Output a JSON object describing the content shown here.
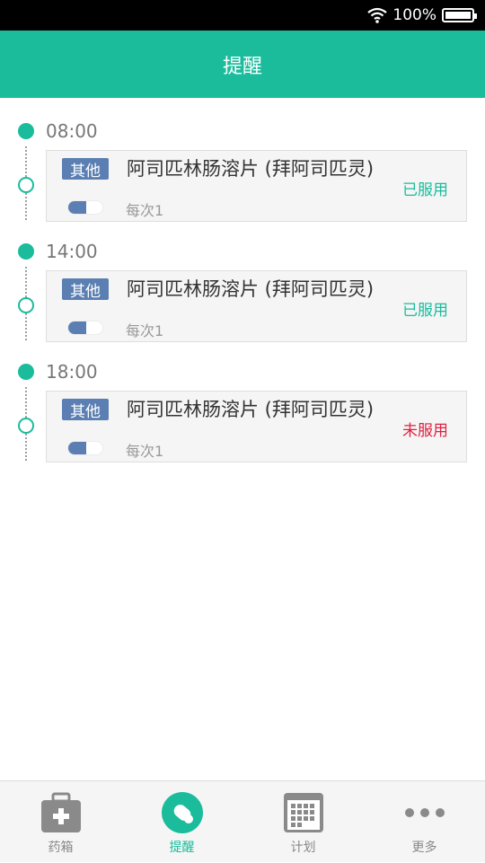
{
  "status_bar": {
    "battery_text": "100%"
  },
  "header": {
    "title": "提醒"
  },
  "reminders": [
    {
      "time": "08:00",
      "tag": "其他",
      "drug": "阿司匹林肠溶片 (拜阿司匹灵)",
      "dose": "每次1",
      "status": "已服用",
      "status_color": "#1abc9c"
    },
    {
      "time": "14:00",
      "tag": "其他",
      "drug": "阿司匹林肠溶片 (拜阿司匹灵)",
      "dose": "每次1",
      "status": "已服用",
      "status_color": "#1abc9c"
    },
    {
      "time": "18:00",
      "tag": "其他",
      "drug": "阿司匹林肠溶片 (拜阿司匹灵)",
      "dose": "每次1",
      "status": "未服用",
      "status_color": "#e02040"
    }
  ],
  "tabs": [
    {
      "label": "药箱",
      "icon": "medicine-box-icon"
    },
    {
      "label": "提醒",
      "icon": "pill-icon",
      "active": true
    },
    {
      "label": "计划",
      "icon": "calendar-icon"
    },
    {
      "label": "更多",
      "icon": "more-dots-icon"
    }
  ],
  "colors": {
    "accent": "#1abc9c",
    "tag": "#5b7fb2",
    "missed": "#e02040"
  }
}
